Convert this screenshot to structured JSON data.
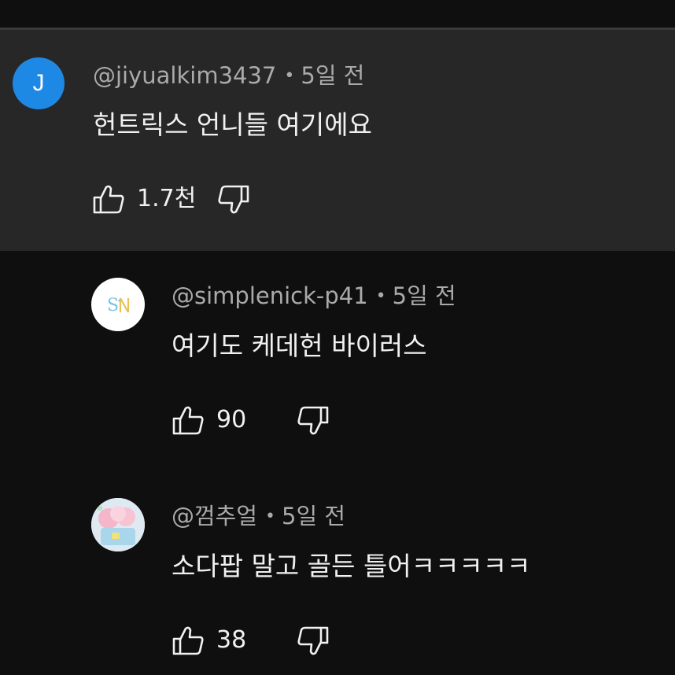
{
  "comments": [
    {
      "avatar_letter": "J",
      "avatar_color": "#1e88e5",
      "handle": "@jiyualkim3437",
      "time": "5일 전",
      "text": "헌트릭스 언니들 여기에요",
      "likes": "1.7천",
      "highlighted": true
    },
    {
      "avatar_letter": "SN",
      "avatar_color": "#ffffff",
      "handle": "@simplenick-p41",
      "time": "5일 전",
      "text": "여기도 케데헌 바이러스",
      "likes": "90",
      "highlighted": false
    },
    {
      "avatar_letter": "",
      "avatar_color": "#dfe9f2",
      "handle": "@껌추얼",
      "time": "5일 전",
      "text": "소다팝 말고 골든 틀어ㅋㅋㅋㅋㅋ",
      "likes": "38",
      "highlighted": false
    }
  ],
  "separator": "•",
  "icons": {
    "like": "thumbs-up-icon",
    "dislike": "thumbs-down-icon"
  }
}
